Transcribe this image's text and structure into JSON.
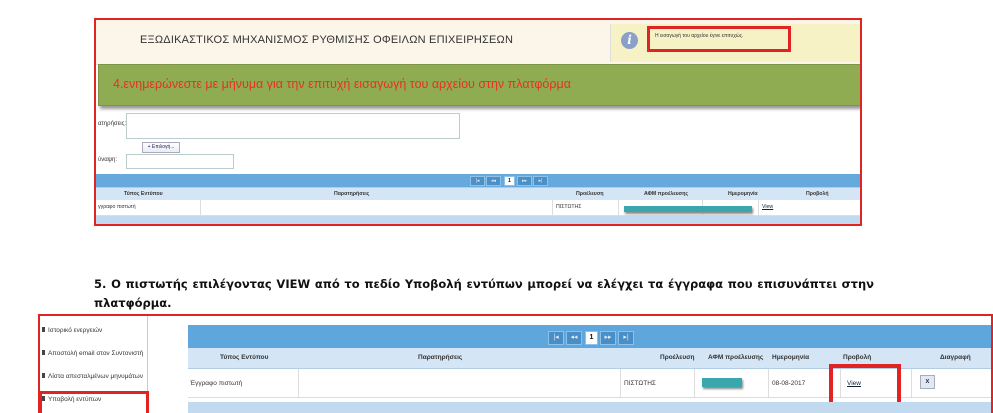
{
  "top_screenshot": {
    "title": "ΕΞΩΔΙΚΑΣΤΙΚΟΣ ΜΗΧΑΝΙΣΜΟΣ ΡΥΘΜΙΣΗΣ ΟΦΕΙΛΩΝ ΕΠΙΧΕΙΡΗΣΕΩΝ",
    "notice": "Η εισαγωγή του αρχείου έγινε επιτυχώς.",
    "banner": "4.ενημερώνεστε με μήνυμα για την επιτυχή εισαγωγή του αρχείου στην πλατφόρμα",
    "observations_label": "ατηρήσεις:",
    "attach_label": "ύναψη:",
    "add_button": "+ Επιλογή...",
    "pager": [
      "|◂",
      "◂◂",
      "1",
      "▸▸",
      "▸|"
    ],
    "columns": [
      "Τύπος Εντύπου",
      "Παρατηρήσεις",
      "Προέλευση",
      "ΑΦΜ προέλευσης",
      "Ημερομηνία",
      "Προβολή"
    ],
    "row": {
      "type": "γγραφο πιστωτή",
      "notes": "",
      "origin": "ΠΙΣΤΩΤΗΣ",
      "view": "View"
    }
  },
  "instruction": "5. Ο πιστωτής επιλέγοντας VIEW από το πεδίο Υποβολή εντύπων μπορεί να ελέγχει τα έγγραφα που επισυνάπτει στην πλατφόρμα.",
  "bottom_screenshot": {
    "sidebar": [
      "Ιστορικό ενεργειών",
      "Αποστολή email στον Συντονιστή",
      "Λίστα απεσταλμένων μηνυμάτων",
      "Υποβολή εντύπων"
    ],
    "pager": [
      "|◂",
      "◂◂",
      "1",
      "▸▸",
      "▸|"
    ],
    "columns": [
      "Τύπος Εντύπου",
      "Παρατηρήσεις",
      "Προέλευση",
      "ΑΦΜ προέλευσης",
      "Ημερομηνία",
      "Προβολή",
      "Διαγραφή"
    ],
    "row": {
      "type": "Έγγραφο πιστωτή",
      "notes": "",
      "origin": "ΠΙΣΤΩΤΗΣ",
      "date": "08-08-2017",
      "view": "View",
      "delete": "x"
    }
  },
  "colors": {
    "highlight": "#e02424",
    "banner": "#90ac52",
    "banner_text": "#e8321c",
    "pager": "#5fa6dc",
    "teal": "#3aa6ae"
  }
}
